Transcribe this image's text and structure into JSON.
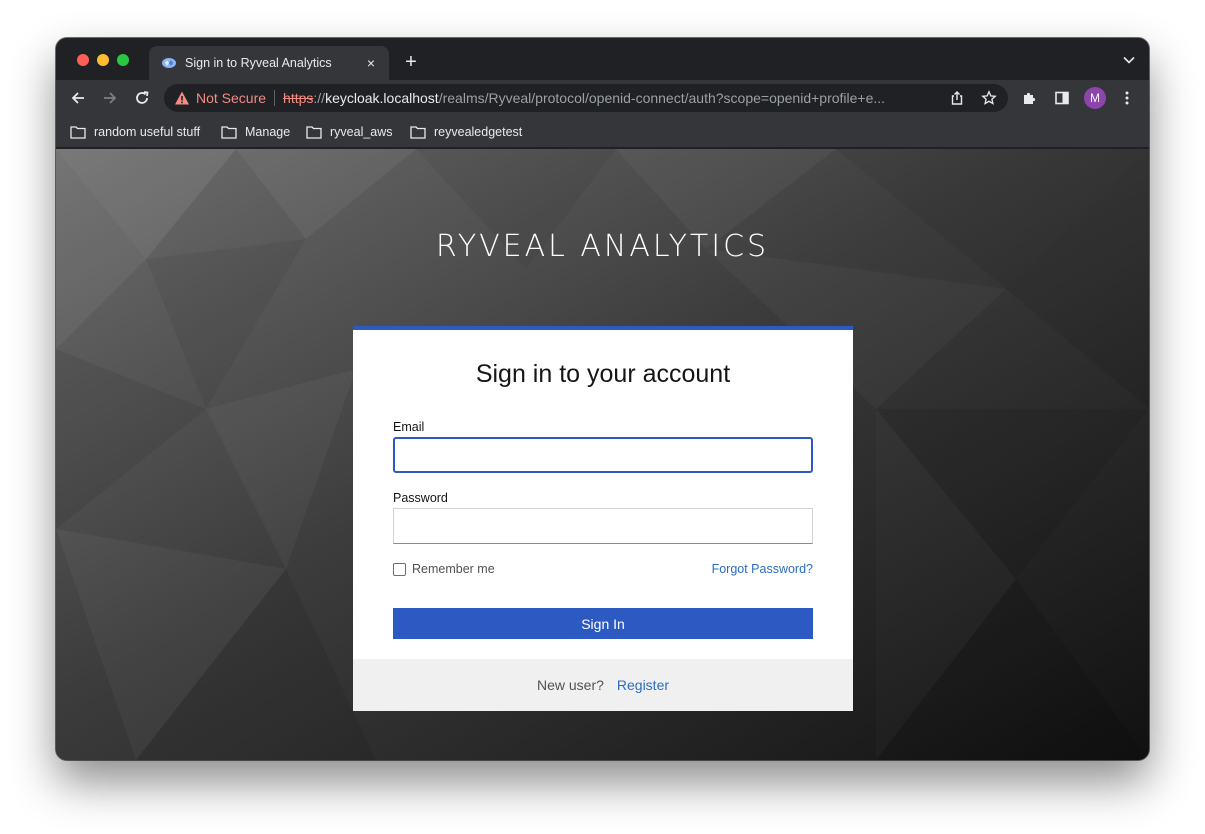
{
  "browser": {
    "tab": {
      "title": "Sign in to Ryveal Analytics",
      "close_glyph": "×",
      "favicon": "keycloak-icon"
    },
    "new_tab_glyph": "+",
    "toolbar": {
      "security_label": "Not Secure",
      "url": {
        "scheme": "https",
        "separator": "://",
        "host": "keycloak.localhost",
        "path": "/realms/Ryveal/protocol/openid-connect/auth?scope=openid+profile+e..."
      },
      "avatar_initial": "M"
    },
    "bookmarks": [
      {
        "label": "random useful stuff"
      },
      {
        "label": "Manage"
      },
      {
        "label": "ryveal_aws"
      },
      {
        "label": "reyvealedgetest"
      }
    ]
  },
  "login": {
    "brand": "RYVEAL ANALYTICS",
    "title": "Sign in to your account",
    "email_label": "Email",
    "email_value": "",
    "password_label": "Password",
    "password_value": "",
    "remember_label": "Remember me",
    "remember_checked": false,
    "forgot_label": "Forgot Password?",
    "submit_label": "Sign In",
    "new_user_label": "New user?",
    "register_label": "Register"
  },
  "colors": {
    "primary": "#2d5ac2",
    "link": "#2d6cc0",
    "not_secure": "#f28b82",
    "avatar": "#8e44ad"
  }
}
